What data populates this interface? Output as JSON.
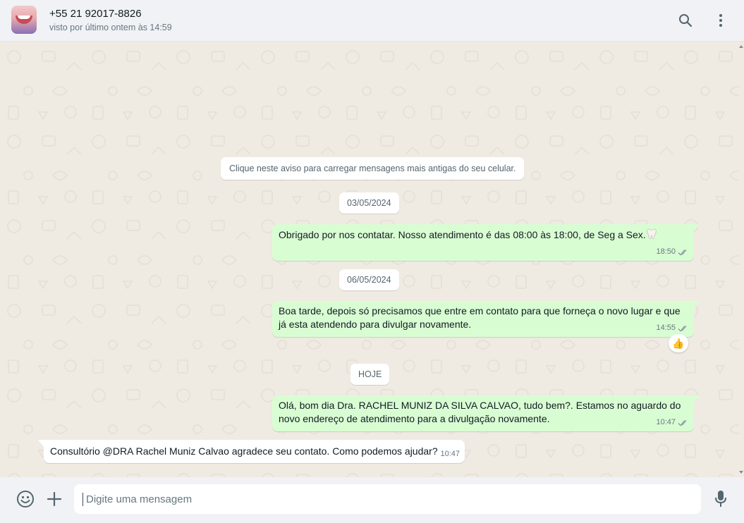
{
  "header": {
    "contact_name": "+55 21 92017-8826",
    "last_seen": "visto por último ontem às 14:59"
  },
  "chat": {
    "load_older_notice": "Clique neste aviso para carregar mensagens mais antigas do seu celular.",
    "dates": [
      "03/05/2024",
      "06/05/2024",
      "HOJE"
    ],
    "messages": [
      {
        "direction": "outgoing",
        "text": "Obrigado por nos contatar. Nosso atendimento é das 08:00 às 18:00, de Seg a Sex.",
        "emoji": "tooth",
        "time": "18:50",
        "status": "read"
      },
      {
        "direction": "outgoing",
        "text_line1": "Boa tarde, depois só precisamos que entre em contato para que forneça o novo lugar e que",
        "text_line2": "já esta atendendo para divulgar novamente.",
        "time": "14:55",
        "status": "read",
        "reaction": "👍"
      },
      {
        "direction": "outgoing",
        "text_line1": "Olá, bom dia Dra. RACHEL MUNIZ DA SILVA CALVAO, tudo bem?. Estamos no aguardo do",
        "text_line2": "novo endereço de atendimento para a divulgação novamente.",
        "time": "10:47",
        "status": "read"
      },
      {
        "direction": "incoming",
        "text": "Consultório @DRA Rachel Muniz Calvao agradece seu contato. Como podemos ajudar?",
        "time": "10:47"
      }
    ]
  },
  "composer": {
    "placeholder": "Digite uma mensagem",
    "value": ""
  },
  "icons": {
    "header": [
      "search-icon",
      "menu-icon"
    ],
    "footer": [
      "emoji-icon",
      "plus-icon",
      "mic-icon"
    ]
  },
  "colors": {
    "chat_background": "#efeae2",
    "outgoing_bubble": "#d9fdd3",
    "incoming_bubble": "#ffffff",
    "header_footer": "#f0f2f5",
    "read_ticks": "#8696a0"
  }
}
